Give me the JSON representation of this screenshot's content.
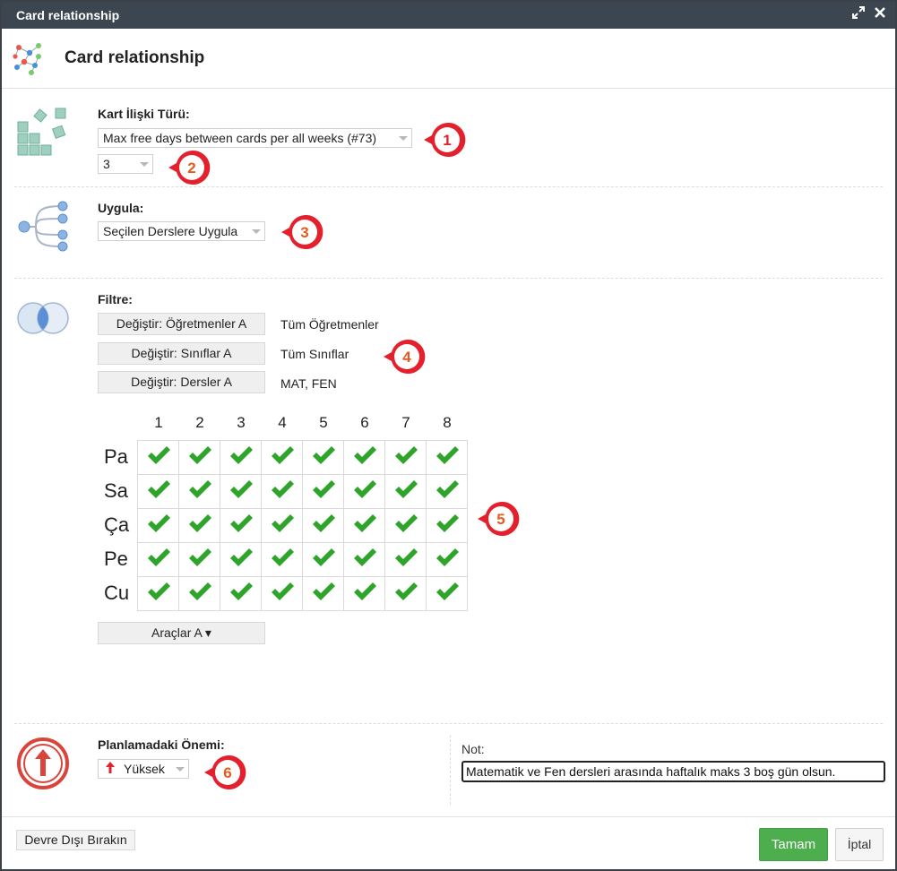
{
  "window": {
    "title": "Card relationship",
    "maximize_icon": "expand-arrows-icon",
    "close_icon": "close-x-icon"
  },
  "header": {
    "title": "Card relationship",
    "icon": "network-graph-icon"
  },
  "relation_type": {
    "label": "Kart İlişki Türü:",
    "value": "Max free days between cards per all weeks (#73)",
    "number_value": "3",
    "icon": "cards-stack-icon"
  },
  "apply": {
    "label": "Uygula:",
    "value": "Seçilen Derslere Uygula",
    "icon": "branch-tree-icon"
  },
  "filter": {
    "label": "Filtre:",
    "icon": "venn-circles-icon",
    "rows": [
      {
        "button": "Değiştir: Öğretmenler A",
        "value": "Tüm Öğretmenler"
      },
      {
        "button": "Değiştir: Sınıflar A",
        "value": "Tüm Sınıflar"
      },
      {
        "button": "Değiştir: Dersler A",
        "value": "MAT, FEN"
      }
    ]
  },
  "grid": {
    "columns": [
      "1",
      "2",
      "3",
      "4",
      "5",
      "6",
      "7",
      "8"
    ],
    "rows": [
      "Pa",
      "Sa",
      "Ça",
      "Pe",
      "Cu"
    ],
    "cell_icon": "green-check-icon",
    "check_color": "#2ea52a",
    "tools_button": "Araçlar A ▾"
  },
  "importance": {
    "label": "Planlamadaki Önemi:",
    "value": "Yüksek",
    "icon": "arrow-up-circle-icon",
    "color": "#d9453b"
  },
  "note": {
    "label": "Not:",
    "value": "Matematik ve Fen dersleri arasında haftalık maks 3 boş gün olsun."
  },
  "callouts": [
    "1",
    "2",
    "3",
    "4",
    "5",
    "6"
  ],
  "callout_color": "#e3202c",
  "footer": {
    "disable_button": "Devre Dışı Bırakın",
    "ok_button": "Tamam",
    "cancel_button": "İptal"
  }
}
